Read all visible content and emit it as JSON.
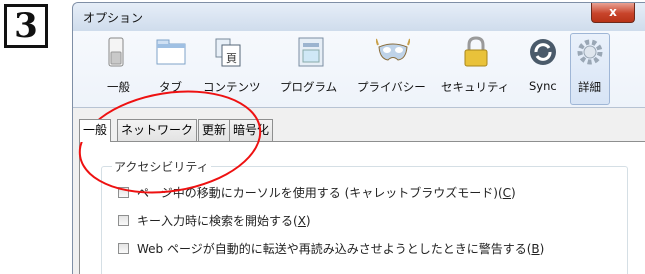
{
  "step_badge": "3",
  "window": {
    "title": "オプション",
    "close_label": "x"
  },
  "toolbar": {
    "panes": [
      {
        "label": "一般",
        "icon": "switch-icon"
      },
      {
        "label": "タブ",
        "icon": "tab-window-icon"
      },
      {
        "label": "コンテンツ",
        "icon": "document-icon"
      },
      {
        "label": "プログラム",
        "icon": "application-icon"
      },
      {
        "label": "プライバシー",
        "icon": "mask-icon"
      },
      {
        "label": "セキュリティ",
        "icon": "padlock-icon"
      },
      {
        "label": "Sync",
        "icon": "sync-icon"
      },
      {
        "label": "詳細",
        "icon": "gear-icon",
        "selected": true
      }
    ]
  },
  "subtabs": [
    "一般",
    "ネットワーク",
    "更新",
    "暗号化"
  ],
  "active_subtab": "一般",
  "accessibility": {
    "legend": "アクセシビリティ",
    "options": [
      {
        "text": "ページ中の移動にカーソルを使用する (キャレットブラウズモード)(",
        "key": "C",
        "suffix": ")",
        "checked": false
      },
      {
        "text": "キー入力時に検索を開始する(",
        "key": "X",
        "suffix": ")",
        "checked": false
      },
      {
        "text": "Web ページが自動的に転送や再読み込みさせようとしたときに警告する(",
        "key": "B",
        "suffix": ")",
        "checked": false
      }
    ]
  },
  "colors": {
    "annotation_ring": "#ee1111",
    "titlebar": "#cfdcec",
    "close_button": "#c8442a"
  }
}
